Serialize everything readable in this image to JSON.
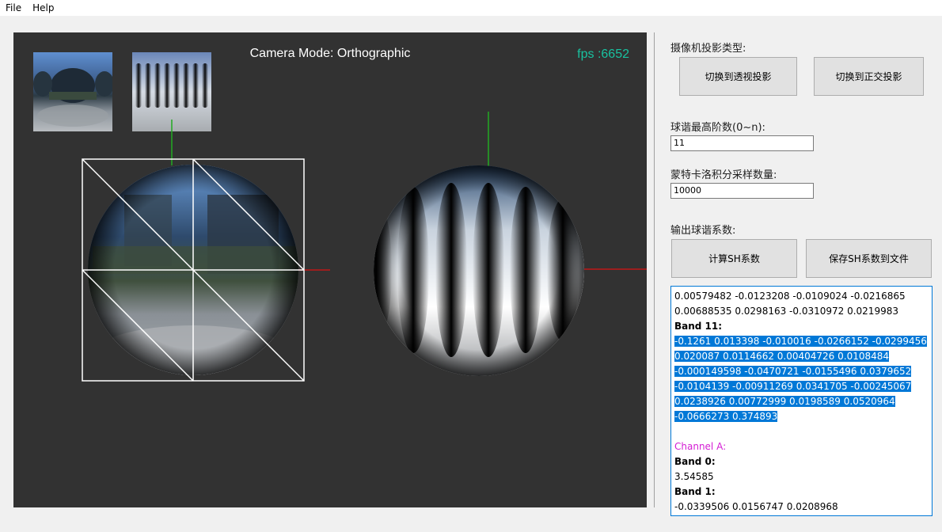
{
  "menu": {
    "items": [
      "File",
      "Help"
    ]
  },
  "viewport": {
    "camera_mode": "Camera Mode: Orthographic",
    "fps": "fps :6652"
  },
  "panel": {
    "projection_label": "摄像机投影类型:",
    "btn_perspective": "切换到透视投影",
    "btn_orthographic": "切换到正交投影",
    "sh_order_label": "球谐最高阶数(0~n):",
    "sh_order_value": "11",
    "samples_label": "蒙特卡洛积分采样数量:",
    "samples_value": "10000",
    "output_label": "输出球谐系数:",
    "btn_compute": "计算SH系数",
    "btn_save": "保存SH系数到文件"
  },
  "output": {
    "lines": [
      "0.00579482 -0.0123208 -0.0109024 -0.0216865",
      "0.00688535 0.0298163 -0.0310972 0.0219983",
      "Band 11:",
      "-0.1261 0.013398 -0.010016 -0.0266152 -0.0299456",
      "0.020087 0.0114662 0.00404726 0.0108484",
      "-0.000149598 -0.0470721 -0.0155496 0.0379652",
      "-0.0104139 -0.00911269 0.0341705 -0.00245067",
      "0.0238926 0.00772999 0.0198589 0.0520964",
      "-0.0666273 0.374893",
      "",
      "Channel A:",
      "Band 0:",
      "3.54585",
      "Band 1:",
      "-0.0339506 0.0156747 0.0208968"
    ]
  },
  "colors": {
    "viewport_bg": "#323232",
    "fps_color": "#19c2a0",
    "axis_green": "#22aa22",
    "axis_red": "#c01818",
    "selection": "#0078d7",
    "channel_label": "#d41cd4"
  }
}
